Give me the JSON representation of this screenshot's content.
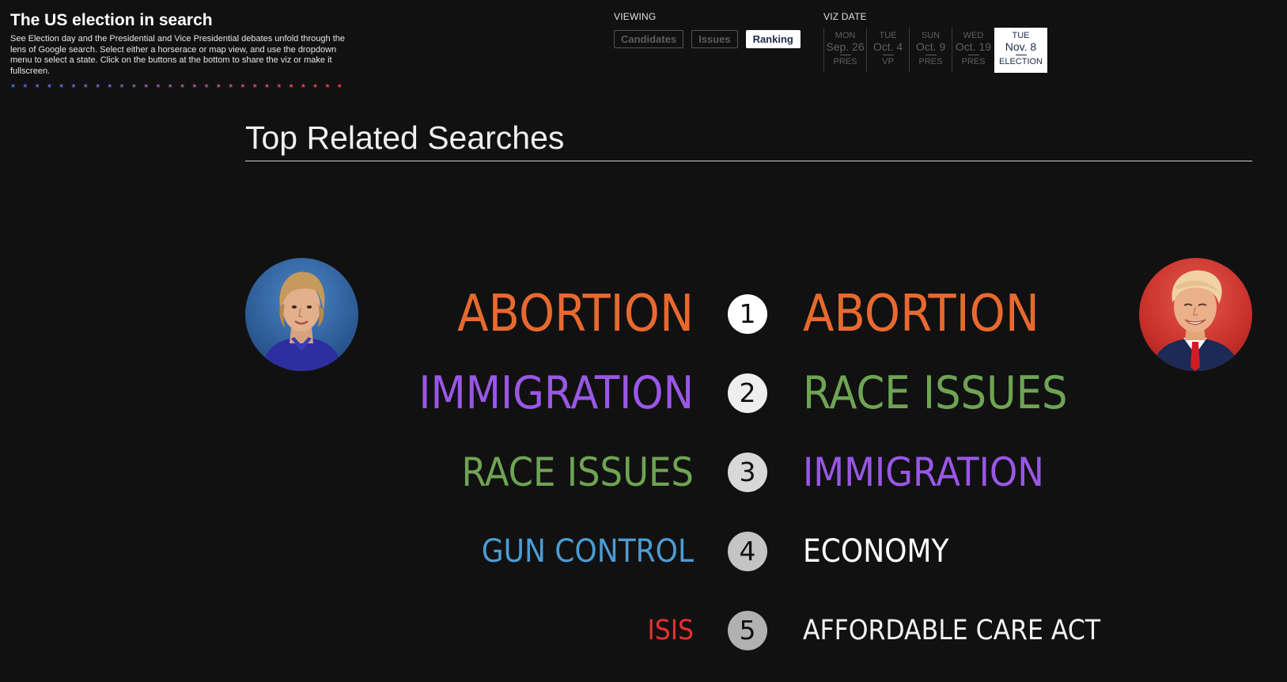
{
  "header": {
    "title": "The US election in search",
    "description": "See Election day and the Presidential and Vice Presidential debates unfold through the lens of Google search. Select either a horserace or map view, and use the dropdown menu to select a state. Click on the buttons at the bottom to share the viz or make it fullscreen.",
    "star_colors": [
      "#4a6fd6",
      "#4f6bd3",
      "#566ad0",
      "#5c68cc",
      "#6366c9",
      "#6a64c5",
      "#7162c1",
      "#7860bd",
      "#7f5eb9",
      "#865cb4",
      "#8d5aaf",
      "#9458aa",
      "#9b56a5",
      "#a254a0",
      "#a9529a",
      "#b05094",
      "#b74e8e",
      "#be4c88",
      "#c54a81",
      "#cc487a",
      "#d34673",
      "#d9446c",
      "#e04265",
      "#e6405d",
      "#ec3e55",
      "#f23c4d",
      "#f83a45",
      "#fe383d"
    ]
  },
  "viewing": {
    "label": "VIEWING",
    "buttons": [
      {
        "label": "Candidates",
        "active": false
      },
      {
        "label": "Issues",
        "active": false
      },
      {
        "label": "Ranking",
        "active": true
      }
    ]
  },
  "viz_date": {
    "label": "VIZ DATE",
    "dates": [
      {
        "dow": "MON",
        "date": "Sep. 26",
        "event": "PRES",
        "active": false
      },
      {
        "dow": "TUE",
        "date": "Oct. 4",
        "event": "VP",
        "active": false
      },
      {
        "dow": "SUN",
        "date": "Oct. 9",
        "event": "PRES",
        "active": false
      },
      {
        "dow": "WED",
        "date": "Oct. 19",
        "event": "PRES",
        "active": false
      },
      {
        "dow": "TUE",
        "date": "Nov. 8",
        "event": "ELECTION",
        "active": true
      }
    ]
  },
  "section_title": "Top Related Searches",
  "candidates": {
    "left": {
      "portrait": "clinton-portrait"
    },
    "right": {
      "portrait": "trump-portrait"
    }
  },
  "rankings": [
    {
      "rank": "1",
      "left": "ABORTION",
      "left_color": "#e8692f",
      "right": "ABORTION",
      "right_color": "#e8692f",
      "badge_color": "#ffffff"
    },
    {
      "rank": "2",
      "left": "IMMIGRATION",
      "left_color": "#9957e6",
      "right": "RACE ISSUES",
      "right_color": "#6ea453",
      "badge_color": "#eeeeee"
    },
    {
      "rank": "3",
      "left": "RACE ISSUES",
      "left_color": "#6ea453",
      "right": "IMMIGRATION",
      "right_color": "#9957e6",
      "badge_color": "#d8d8d8"
    },
    {
      "rank": "4",
      "left": "GUN CONTROL",
      "left_color": "#4d9cd3",
      "right": "ECONOMY",
      "right_color": "#ffffff",
      "badge_color": "#c4c4c4"
    },
    {
      "rank": "5",
      "left": "ISIS",
      "left_color": "#e2322f",
      "right": "AFFORDABLE CARE ACT",
      "right_color": "#f2f2f2",
      "badge_color": "#b1b1b1"
    }
  ]
}
